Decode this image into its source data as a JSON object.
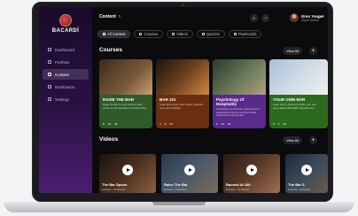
{
  "brand": {
    "name": "BACARDÍ"
  },
  "sidebar": {
    "items": [
      {
        "label": "Dashboard",
        "icon": "grid-icon",
        "active": false
      },
      {
        "label": "Portfolio",
        "icon": "folder-icon",
        "active": false
      },
      {
        "label": "Content",
        "icon": "content-icon",
        "active": true
      },
      {
        "label": "Distribution",
        "icon": "share-icon",
        "active": false
      },
      {
        "label": "Settings",
        "icon": "gear-icon",
        "active": false
      }
    ]
  },
  "header": {
    "breadcrumb": "Content",
    "user": {
      "name": "Eren Yeager",
      "role": "Super Admin"
    }
  },
  "tabs": [
    {
      "label": "All Content",
      "active": true
    },
    {
      "label": "Courses",
      "active": false
    },
    {
      "label": "Videos",
      "active": false
    },
    {
      "label": "Quizzes",
      "active": false
    },
    {
      "label": "Flashcards",
      "active": false
    }
  ],
  "courses": {
    "title": "Courses",
    "view_all": "View All",
    "cards": [
      {
        "title": "RAISE THE BAR",
        "description": "Raise the Bar is a bar-science video series on the foundations of bartending.",
        "meta": [
          "8",
          "12",
          "30"
        ],
        "color": "#2f5b2a"
      },
      {
        "title": "BAR 101",
        "description": "Learn about bars, their origins, specifics and responsibilities.",
        "meta": [
          "4",
          "8",
          "15"
        ],
        "color": "#6a2f10"
      },
      {
        "title": "Psychology Of Hospitality",
        "description": "Hospitality is a business, approached to understand how the customers build relationships with people.",
        "meta": [
          "6",
          "10",
          "20"
        ],
        "color": "#5a2a8a"
      },
      {
        "title": "YOUR OWN BAR",
        "description": "Learn how to build and create your own personalised BACARDÍ Signature bar.",
        "meta": [
          "5",
          "9",
          "18"
        ],
        "color": "#2b6a1e"
      }
    ]
  },
  "videos": {
    "title": "Videos",
    "view_all": "View All",
    "items": [
      {
        "title": "The Bar Spoon",
        "sub": "Duration - 10 Minutes"
      },
      {
        "title": "Raise The Bar",
        "sub": "Duration - 8 Minutes"
      },
      {
        "title": "Bacardi At 160",
        "sub": "Duration - 12 Minutes"
      },
      {
        "title": "The Bar S",
        "sub": "Duration - 9 Minutes"
      }
    ]
  }
}
